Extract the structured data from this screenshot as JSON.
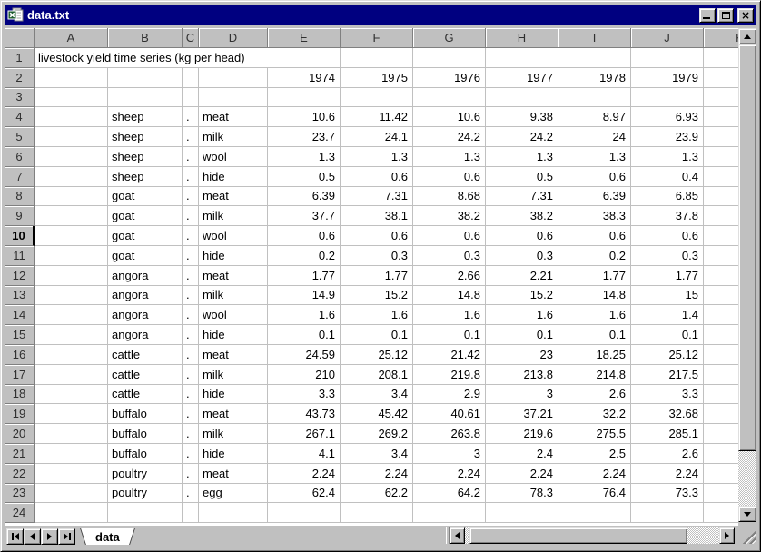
{
  "window": {
    "title": "data.txt",
    "controls": {
      "minimize": "minimize",
      "maximize": "maximize",
      "close": "×"
    }
  },
  "colors": {
    "titlebar": "#000080",
    "chrome": "#c0c0c0",
    "gridline": "#c0c0c0",
    "cell_background": "#ffffff",
    "title_text": "#ffffff"
  },
  "grid": {
    "columns": [
      "A",
      "B",
      "C",
      "D",
      "E",
      "F",
      "G",
      "H",
      "I",
      "J",
      "K"
    ],
    "row_count": 24,
    "active_row": "10",
    "row1_text": "livestock yield time series (kg per head)",
    "years": [
      "1974",
      "1975",
      "1976",
      "1977",
      "1978",
      "1979"
    ],
    "records": [
      {
        "row": 4,
        "animal": "sheep",
        "dot": ".",
        "product": "meat",
        "values": [
          "10.6",
          "11.42",
          "10.6",
          "9.38",
          "8.97",
          "6.93"
        ]
      },
      {
        "row": 5,
        "animal": "sheep",
        "dot": ".",
        "product": "milk",
        "values": [
          "23.7",
          "24.1",
          "24.2",
          "24.2",
          "24",
          "23.9"
        ]
      },
      {
        "row": 6,
        "animal": "sheep",
        "dot": ".",
        "product": "wool",
        "values": [
          "1.3",
          "1.3",
          "1.3",
          "1.3",
          "1.3",
          "1.3"
        ]
      },
      {
        "row": 7,
        "animal": "sheep",
        "dot": ".",
        "product": "hide",
        "values": [
          "0.5",
          "0.6",
          "0.6",
          "0.5",
          "0.6",
          "0.4"
        ]
      },
      {
        "row": 8,
        "animal": "goat",
        "dot": ".",
        "product": "meat",
        "values": [
          "6.39",
          "7.31",
          "8.68",
          "7.31",
          "6.39",
          "6.85"
        ]
      },
      {
        "row": 9,
        "animal": "goat",
        "dot": ".",
        "product": "milk",
        "values": [
          "37.7",
          "38.1",
          "38.2",
          "38.2",
          "38.3",
          "37.8"
        ]
      },
      {
        "row": 10,
        "animal": "goat",
        "dot": ".",
        "product": "wool",
        "values": [
          "0.6",
          "0.6",
          "0.6",
          "0.6",
          "0.6",
          "0.6"
        ]
      },
      {
        "row": 11,
        "animal": "goat",
        "dot": ".",
        "product": "hide",
        "values": [
          "0.2",
          "0.3",
          "0.3",
          "0.3",
          "0.2",
          "0.3"
        ]
      },
      {
        "row": 12,
        "animal": "angora",
        "dot": ".",
        "product": "meat",
        "values": [
          "1.77",
          "1.77",
          "2.66",
          "2.21",
          "1.77",
          "1.77"
        ]
      },
      {
        "row": 13,
        "animal": "angora",
        "dot": ".",
        "product": "milk",
        "values": [
          "14.9",
          "15.2",
          "14.8",
          "15.2",
          "14.8",
          "15"
        ]
      },
      {
        "row": 14,
        "animal": "angora",
        "dot": ".",
        "product": "wool",
        "values": [
          "1.6",
          "1.6",
          "1.6",
          "1.6",
          "1.6",
          "1.4"
        ]
      },
      {
        "row": 15,
        "animal": "angora",
        "dot": ".",
        "product": "hide",
        "values": [
          "0.1",
          "0.1",
          "0.1",
          "0.1",
          "0.1",
          "0.1"
        ]
      },
      {
        "row": 16,
        "animal": "cattle",
        "dot": ".",
        "product": "meat",
        "values": [
          "24.59",
          "25.12",
          "21.42",
          "23",
          "18.25",
          "25.12"
        ]
      },
      {
        "row": 17,
        "animal": "cattle",
        "dot": ".",
        "product": "milk",
        "values": [
          "210",
          "208.1",
          "219.8",
          "213.8",
          "214.8",
          "217.5"
        ]
      },
      {
        "row": 18,
        "animal": "cattle",
        "dot": ".",
        "product": "hide",
        "values": [
          "3.3",
          "3.4",
          "2.9",
          "3",
          "2.6",
          "3.3"
        ]
      },
      {
        "row": 19,
        "animal": "buffalo",
        "dot": ".",
        "product": "meat",
        "values": [
          "43.73",
          "45.42",
          "40.61",
          "37.21",
          "32.2",
          "32.68"
        ]
      },
      {
        "row": 20,
        "animal": "buffalo",
        "dot": ".",
        "product": "milk",
        "values": [
          "267.1",
          "269.2",
          "263.8",
          "219.6",
          "275.5",
          "285.1"
        ]
      },
      {
        "row": 21,
        "animal": "buffalo",
        "dot": ".",
        "product": "hide",
        "values": [
          "4.1",
          "3.4",
          "3",
          "2.4",
          "2.5",
          "2.6"
        ]
      },
      {
        "row": 22,
        "animal": "poultry",
        "dot": ".",
        "product": "meat",
        "values": [
          "2.24",
          "2.24",
          "2.24",
          "2.24",
          "2.24",
          "2.24"
        ]
      },
      {
        "row": 23,
        "animal": "poultry",
        "dot": ".",
        "product": "egg",
        "values": [
          "62.4",
          "62.2",
          "64.2",
          "78.3",
          "76.4",
          "73.3"
        ]
      }
    ]
  },
  "tabbar": {
    "sheet_tab": "data",
    "nav": [
      "first-sheet",
      "previous-sheet",
      "next-sheet",
      "last-sheet"
    ]
  }
}
